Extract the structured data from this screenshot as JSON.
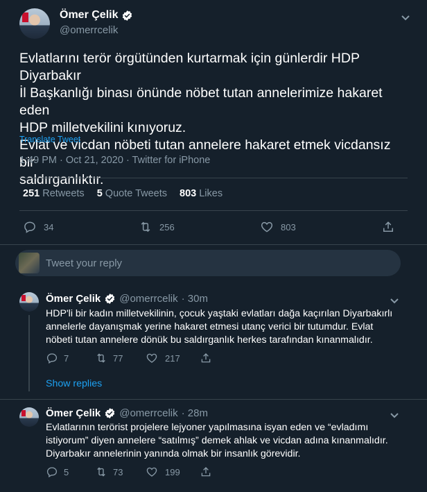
{
  "main_tweet": {
    "author_name": "Ömer Çelik",
    "author_handle": "@omerrcelik",
    "text_lines": [
      "Evlatlarını terör örgütünden kurtarmak için günlerdir HDP Diyarbakır",
      "İl Başkanlığı binası önünde nöbet tutan annelerimize hakaret eden",
      "HDP milletvekilini kınıyoruz.",
      "Evlat ve vicdan nöbeti tutan annelere hakaret etmek vicdansız bir",
      "saldırganlıktır."
    ],
    "translate_label": "Translate Tweet",
    "timestamp": "1:49 PM · Oct 21, 2020 · Twitter for iPhone",
    "retweets_count": "251",
    "retweets_label": "Retweets",
    "quote_count": "5",
    "quote_label": "Quote Tweets",
    "likes_count": "803",
    "likes_label": "Likes",
    "actions": {
      "reply": "34",
      "retweet": "256",
      "like": "803"
    }
  },
  "reply_box": {
    "placeholder": "Tweet your reply"
  },
  "replies": [
    {
      "author_name": "Ömer Çelik",
      "author_handle": "@omerrcelik",
      "time": "· 30m",
      "text_lines": [
        "HDP'li bir kadın milletvekilinin, çocuk yaştaki evlatları dağa kaçırılan Diyarbakırlı",
        "annelerle dayanışmak yerine hakaret etmesi utanç verici bir tutumdur. Evlat",
        "nöbeti tutan annelere dönük bu saldırganlık herkes tarafından kınanmalıdır."
      ],
      "actions": {
        "reply": "7",
        "retweet": "77",
        "like": "217"
      },
      "show_replies_label": "Show replies"
    },
    {
      "author_name": "Ömer Çelik",
      "author_handle": "@omerrcelik",
      "time": "· 28m",
      "text_lines": [
        "Evlatlarının terörist projelere lejyoner yapılmasına isyan eden ve “evladımı",
        "istiyorum” diyen annelere “satılmış” demek ahlak ve vicdan adına kınanmalıdır.",
        "Diyarbakır annelerinin yanında olmak bir insanlık görevidir."
      ],
      "actions": {
        "reply": "5",
        "retweet": "73",
        "like": "199"
      }
    }
  ],
  "colors": {
    "background": "#15202b",
    "accent": "#1da1f2",
    "muted": "#8899a6",
    "divider": "#38444d"
  }
}
